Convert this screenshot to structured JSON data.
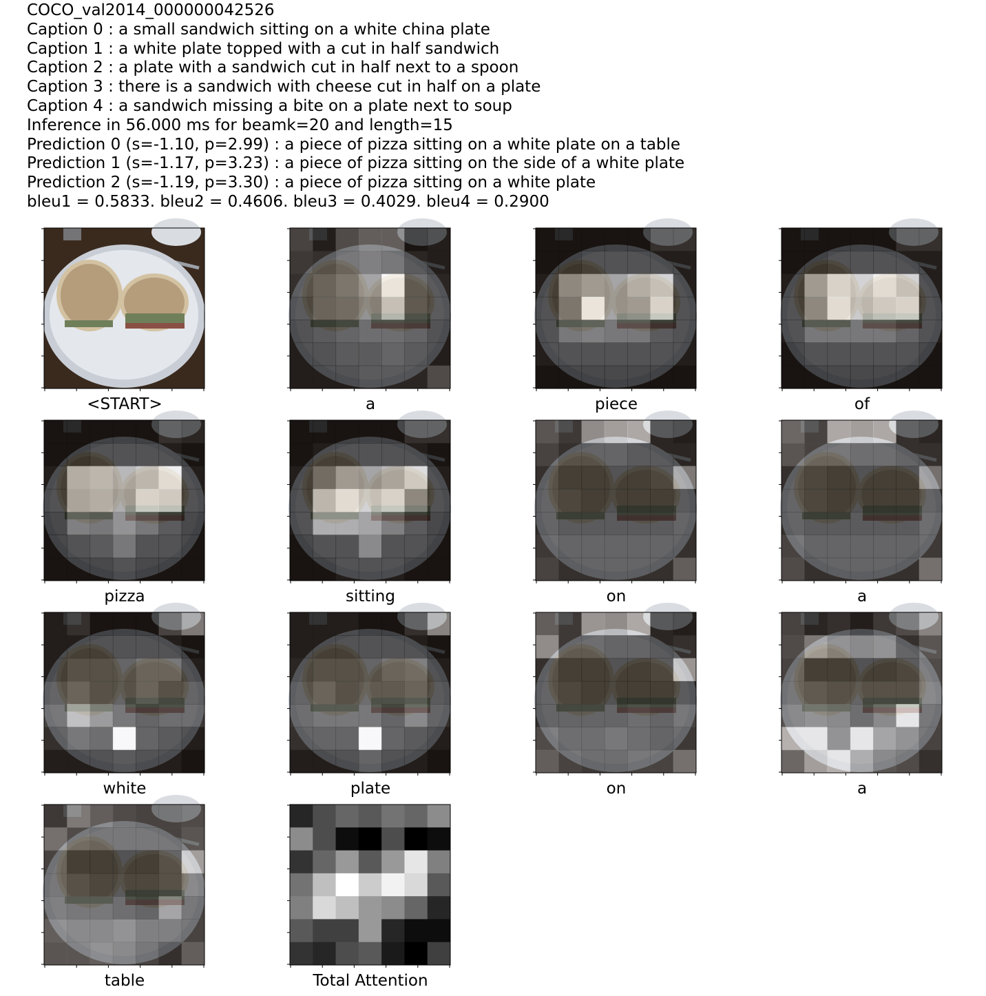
{
  "header": {
    "lines": [
      "COCO_val2014_000000042526",
      "Caption 0 : a small sandwich sitting on a white china plate",
      "Caption 1 : a white plate topped with a cut in half sandwich",
      "Caption 2 : a plate with a sandwich cut in half next to a spoon",
      "Caption 3 : there is a sandwich with cheese cut in half on a plate",
      "Caption 4 : a sandwich missing a bite on a plate next to soup",
      "Inference in 56.000 ms for beamk=20 and length=15",
      "Prediction 0 (s=-1.10, p=2.99) : a piece of pizza sitting on a white plate on a table",
      "Prediction 1 (s=-1.17, p=3.23) : a piece of pizza sitting on the side of a white plate",
      "Prediction 2 (s=-1.19, p=3.30) : a piece of pizza sitting on a white plate",
      "bleu1 = 0.5833. bleu2 = 0.4606. bleu3 = 0.4029. bleu4 = 0.2900"
    ]
  },
  "chart_data": {
    "type": "heatmap",
    "grid_size": 7,
    "colormap": "gray",
    "photo": {
      "description_role": "background photograph of a sandwich on a white plate",
      "colors": {
        "table": "#3a2a1e",
        "plate": "#e4e7ec",
        "plate_shadow": "#c9ced6",
        "bread": "#b59d7c",
        "bread_light": "#d3c2a2",
        "filling": "#6f7f5a",
        "meat": "#8a4f45",
        "bowl": "#d9dde2",
        "spoon": "#9aa0a6"
      }
    },
    "panels": [
      {
        "word": "<START>",
        "overlay": false,
        "values": []
      },
      {
        "word": "a",
        "overlay": true,
        "values": [
          [
            0.3,
            0.1,
            0.35,
            0.45,
            0.45,
            0.05,
            0.1
          ],
          [
            0.25,
            0.2,
            0.3,
            0.35,
            0.3,
            0.15,
            0.1
          ],
          [
            0.2,
            0.3,
            0.4,
            0.55,
            1.0,
            0.25,
            0.15
          ],
          [
            0.15,
            0.3,
            0.35,
            0.45,
            0.8,
            0.25,
            0.15
          ],
          [
            0.1,
            0.15,
            0.2,
            0.25,
            0.25,
            0.2,
            0.1
          ],
          [
            0.1,
            0.1,
            0.15,
            0.15,
            0.2,
            0.15,
            0.1
          ],
          [
            0.1,
            0.1,
            0.1,
            0.15,
            0.15,
            0.15,
            0.35
          ]
        ]
      },
      {
        "word": "piece",
        "overlay": true,
        "values": [
          [
            0.05,
            0.05,
            0.05,
            0.05,
            0.05,
            0.2,
            0.2
          ],
          [
            0.05,
            0.05,
            0.1,
            0.1,
            0.1,
            0.1,
            0.1
          ],
          [
            0.1,
            0.5,
            0.6,
            0.55,
            0.7,
            0.8,
            0.1
          ],
          [
            0.1,
            0.4,
            1.0,
            0.55,
            0.6,
            0.9,
            0.1
          ],
          [
            0.1,
            0.3,
            0.35,
            0.3,
            0.3,
            0.15,
            0.1
          ],
          [
            0.1,
            0.1,
            0.1,
            0.1,
            0.1,
            0.1,
            0.1
          ],
          [
            0.05,
            0.05,
            0.05,
            0.05,
            0.05,
            0.05,
            0.05
          ]
        ]
      },
      {
        "word": "of",
        "overlay": true,
        "values": [
          [
            0.05,
            0.05,
            0.05,
            0.05,
            0.05,
            0.2,
            0.2
          ],
          [
            0.05,
            0.05,
            0.1,
            0.1,
            0.1,
            0.1,
            0.1
          ],
          [
            0.1,
            0.6,
            0.9,
            0.8,
            0.95,
            0.8,
            0.1
          ],
          [
            0.1,
            0.5,
            0.95,
            0.75,
            0.85,
            0.9,
            0.1
          ],
          [
            0.1,
            0.3,
            0.3,
            0.3,
            0.3,
            0.2,
            0.1
          ],
          [
            0.05,
            0.1,
            0.1,
            0.1,
            0.1,
            0.1,
            0.05
          ],
          [
            0.05,
            0.05,
            0.05,
            0.05,
            0.05,
            0.05,
            0.05
          ]
        ]
      },
      {
        "word": "pizza",
        "overlay": true,
        "values": [
          [
            0.05,
            0.05,
            0.05,
            0.05,
            0.05,
            0.2,
            0.15
          ],
          [
            0.05,
            0.05,
            0.1,
            0.1,
            0.1,
            0.1,
            0.05
          ],
          [
            0.1,
            0.7,
            0.75,
            0.65,
            0.75,
            0.95,
            0.1
          ],
          [
            0.1,
            0.65,
            0.7,
            0.6,
            0.9,
            0.85,
            0.1
          ],
          [
            0.05,
            0.35,
            0.3,
            0.45,
            0.3,
            0.15,
            0.05
          ],
          [
            0.05,
            0.1,
            0.15,
            0.3,
            0.1,
            0.1,
            0.05
          ],
          [
            0.05,
            0.05,
            0.05,
            0.1,
            0.05,
            0.05,
            0.05
          ]
        ]
      },
      {
        "word": "sitting",
        "overlay": true,
        "values": [
          [
            0.05,
            0.05,
            0.05,
            0.05,
            0.05,
            0.2,
            0.2
          ],
          [
            0.05,
            0.1,
            0.1,
            0.1,
            0.1,
            0.1,
            0.05
          ],
          [
            0.1,
            0.35,
            0.6,
            0.55,
            0.65,
            0.85,
            0.1
          ],
          [
            0.1,
            0.75,
            0.95,
            0.8,
            0.9,
            0.5,
            0.1
          ],
          [
            0.1,
            0.6,
            0.6,
            0.55,
            0.35,
            0.15,
            0.05
          ],
          [
            0.05,
            0.1,
            0.1,
            0.4,
            0.1,
            0.1,
            0.05
          ],
          [
            0.05,
            0.05,
            0.1,
            0.1,
            0.1,
            0.05,
            0.05
          ]
        ]
      },
      {
        "word": "on",
        "overlay": true,
        "values": [
          [
            0.4,
            0.25,
            0.7,
            0.8,
            0.85,
            0.15,
            0.1
          ],
          [
            0.3,
            0.2,
            0.2,
            0.2,
            0.15,
            0.15,
            0.15
          ],
          [
            0.2,
            0.1,
            0.1,
            0.1,
            0.1,
            0.15,
            0.6
          ],
          [
            0.2,
            0.15,
            0.1,
            0.1,
            0.1,
            0.1,
            0.15
          ],
          [
            0.2,
            0.15,
            0.15,
            0.15,
            0.15,
            0.15,
            0.2
          ],
          [
            0.25,
            0.2,
            0.2,
            0.2,
            0.2,
            0.2,
            0.2
          ],
          [
            0.3,
            0.2,
            0.2,
            0.2,
            0.2,
            0.2,
            0.45
          ]
        ]
      },
      {
        "word": "a",
        "overlay": true,
        "values": [
          [
            0.5,
            0.3,
            0.85,
            0.8,
            0.85,
            0.2,
            0.15
          ],
          [
            0.4,
            0.3,
            0.3,
            0.25,
            0.25,
            0.2,
            0.2
          ],
          [
            0.2,
            0.15,
            0.1,
            0.1,
            0.1,
            0.1,
            0.55
          ],
          [
            0.2,
            0.15,
            0.1,
            0.1,
            0.1,
            0.1,
            0.2
          ],
          [
            0.2,
            0.15,
            0.15,
            0.15,
            0.15,
            0.15,
            0.25
          ],
          [
            0.3,
            0.2,
            0.2,
            0.2,
            0.2,
            0.2,
            0.25
          ],
          [
            0.35,
            0.2,
            0.2,
            0.2,
            0.2,
            0.2,
            0.55
          ]
        ]
      },
      {
        "word": "white",
        "overlay": true,
        "values": [
          [
            0.1,
            0.2,
            0.05,
            0.05,
            0.05,
            0.3,
            0.6
          ],
          [
            0.1,
            0.1,
            0.1,
            0.1,
            0.1,
            0.1,
            0.05
          ],
          [
            0.1,
            0.2,
            0.2,
            0.2,
            0.3,
            0.3,
            0.1
          ],
          [
            0.2,
            0.3,
            0.2,
            0.2,
            0.3,
            0.2,
            0.2
          ],
          [
            0.3,
            0.7,
            0.5,
            0.3,
            0.2,
            0.25,
            0.25
          ],
          [
            0.2,
            0.3,
            0.25,
            1.0,
            0.2,
            0.15,
            0.1
          ],
          [
            0.1,
            0.1,
            0.1,
            0.15,
            0.1,
            0.1,
            0.05
          ]
        ]
      },
      {
        "word": "plate",
        "overlay": true,
        "values": [
          [
            0.1,
            0.1,
            0.1,
            0.05,
            0.05,
            0.2,
            0.65
          ],
          [
            0.1,
            0.1,
            0.1,
            0.1,
            0.1,
            0.1,
            0.05
          ],
          [
            0.15,
            0.2,
            0.2,
            0.2,
            0.3,
            0.35,
            0.1
          ],
          [
            0.2,
            0.3,
            0.2,
            0.25,
            0.25,
            0.3,
            0.15
          ],
          [
            0.25,
            0.3,
            0.3,
            0.3,
            0.2,
            0.4,
            0.2
          ],
          [
            0.2,
            0.2,
            0.2,
            1.0,
            0.2,
            0.15,
            0.1
          ],
          [
            0.1,
            0.1,
            0.1,
            0.2,
            0.1,
            0.1,
            0.05
          ]
        ]
      },
      {
        "word": "on",
        "overlay": true,
        "values": [
          [
            0.45,
            0.25,
            0.75,
            0.7,
            0.85,
            0.15,
            0.1
          ],
          [
            0.7,
            0.25,
            0.25,
            0.2,
            0.2,
            0.15,
            0.2
          ],
          [
            0.2,
            0.1,
            0.1,
            0.1,
            0.1,
            0.15,
            0.75
          ],
          [
            0.2,
            0.15,
            0.1,
            0.1,
            0.1,
            0.1,
            0.15
          ],
          [
            0.2,
            0.2,
            0.2,
            0.2,
            0.25,
            0.2,
            0.3
          ],
          [
            0.35,
            0.25,
            0.25,
            0.3,
            0.25,
            0.2,
            0.25
          ],
          [
            0.45,
            0.3,
            0.25,
            0.25,
            0.3,
            0.3,
            0.55
          ]
        ]
      },
      {
        "word": "a",
        "overlay": true,
        "values": [
          [
            0.3,
            0.15,
            0.2,
            0.1,
            0.25,
            0.35,
            0.65
          ],
          [
            0.35,
            0.6,
            0.45,
            0.4,
            0.45,
            0.2,
            0.4
          ],
          [
            0.3,
            0.1,
            0.1,
            0.1,
            0.1,
            0.15,
            0.35
          ],
          [
            0.3,
            0.25,
            0.2,
            0.2,
            0.2,
            0.2,
            0.4
          ],
          [
            0.4,
            0.45,
            0.4,
            0.25,
            0.4,
            0.9,
            0.3
          ],
          [
            0.9,
            0.9,
            0.45,
            0.9,
            0.55,
            0.45,
            0.3
          ],
          [
            0.5,
            0.8,
            0.9,
            0.6,
            0.4,
            0.35,
            0.2
          ]
        ]
      },
      {
        "word": "table",
        "overlay": true,
        "values": [
          [
            0.25,
            0.6,
            0.45,
            0.35,
            0.3,
            0.3,
            0.35
          ],
          [
            0.55,
            0.35,
            0.3,
            0.3,
            0.3,
            0.3,
            0.4
          ],
          [
            0.3,
            0.1,
            0.1,
            0.1,
            0.1,
            0.2,
            0.8
          ],
          [
            0.3,
            0.2,
            0.15,
            0.15,
            0.15,
            0.2,
            0.4
          ],
          [
            0.35,
            0.3,
            0.3,
            0.25,
            0.2,
            0.55,
            0.3
          ],
          [
            0.45,
            0.4,
            0.4,
            0.45,
            0.35,
            0.35,
            0.3
          ],
          [
            0.4,
            0.4,
            0.45,
            0.4,
            0.3,
            0.2,
            0.45
          ]
        ]
      },
      {
        "word": "Total Attention",
        "overlay": false,
        "values": [
          [
            0.15,
            0.3,
            0.4,
            0.35,
            0.45,
            0.4,
            0.55
          ],
          [
            0.55,
            0.3,
            0.05,
            0.0,
            0.3,
            0.0,
            0.05
          ],
          [
            0.2,
            0.4,
            0.6,
            0.35,
            0.6,
            0.9,
            0.5
          ],
          [
            0.45,
            0.75,
            1.0,
            0.8,
            0.95,
            0.85,
            0.35
          ],
          [
            0.5,
            0.85,
            0.75,
            0.6,
            0.55,
            0.4,
            0.15
          ],
          [
            0.35,
            0.25,
            0.25,
            0.6,
            0.15,
            0.05,
            0.05
          ],
          [
            0.2,
            0.15,
            0.3,
            0.35,
            0.1,
            0.0,
            0.25
          ]
        ]
      }
    ]
  }
}
